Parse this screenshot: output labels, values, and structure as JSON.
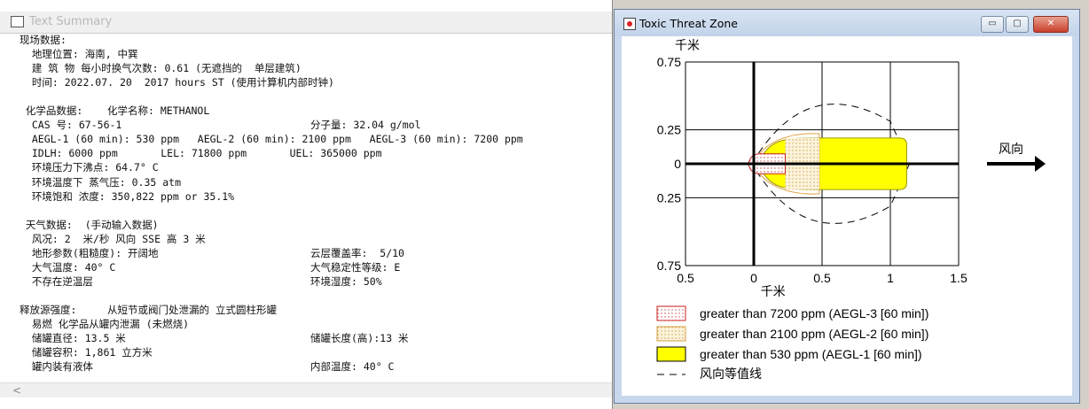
{
  "left_window": {
    "title": "Text Summary",
    "lines": [
      "现场数据:",
      "  地理位置: 海南, 中巽",
      "  建 筑 物 每小时换气次数: 0.61 (无遮挡的  单层建筑)",
      "  时间: 2022.07. 20  2017 hours ST (使用计算机内部时钟)",
      "",
      " 化学品数据:    化学名称: METHANOL",
      "  CAS 号: 67-56-1",
      "  AEGL-1 (60 min): 530 ppm   AEGL-2 (60 min): 2100 ppm   AEGL-3 (60 min): 7200 ppm",
      "  IDLH: 6000 ppm       LEL: 71800 ppm       UEL: 365000 ppm",
      "  环境压力下沸点: 64.7° C",
      "  环境温度下 蒸气压: 0.35 atm",
      "  环境饱和 浓度: 350,822 ppm or 35.1%",
      "",
      " 天气数据:  (手动输入数据)",
      "  风况: 2  米/秒 风向 SSE 高 3 米",
      "  地形参数(粗糙度): 开阔地",
      "  大气温度: 40° C",
      "  不存在逆温层",
      "",
      "释放源强度:     从短节或阀门处泄漏的 立式圆柱形罐",
      "  易燃 化学品从罐内泄漏 (未燃烧)",
      "  储罐直径: 13.5 米",
      "  储罐容积: 1,861 立方米",
      "  罐内装有液体"
    ],
    "right_column": [
      {
        "row": 6,
        "text": "分子量: 32.04 g/mol"
      },
      {
        "row": 15,
        "text": "云层覆盖率:  5/10"
      },
      {
        "row": 16,
        "text": "大气稳定性等级: E"
      },
      {
        "row": 17,
        "text": "环境湿度: 50%"
      },
      {
        "row": 21,
        "text": "储罐长度(高):13 米"
      },
      {
        "row": 23,
        "text": "内部温度: 40° C"
      }
    ],
    "scroll_arrow": "<"
  },
  "right_window": {
    "title": "Toxic Threat Zone",
    "buttons": {
      "minimize": "▭",
      "maximize": "▢",
      "close": "✕"
    },
    "title_icon": "app-icon"
  },
  "chart_data": {
    "type": "area",
    "xlabel": "千米",
    "ylabel": "千米",
    "x_ticks": [
      "0.5",
      "0",
      "0.5",
      "1",
      "1.5"
    ],
    "y_ticks": [
      "0.75",
      "0.25",
      "0",
      "0.25",
      "0.75"
    ],
    "xlim": [
      -0.5,
      1.5
    ],
    "ylim": [
      -0.75,
      0.75
    ],
    "grid": true,
    "wind_label": "风向",
    "zones": [
      {
        "name": "greater than 7200 ppm (AEGL-3 [60 min])",
        "color": "#f4c8c8",
        "edge": "#cc2222",
        "extent_km": 0.23,
        "halfwidth_km": 0.07
      },
      {
        "name": "greater than 2100 ppm (AEGL-2 [60 min])",
        "color": "#f5e6c0",
        "edge": "#e0a040",
        "extent_km": 0.48,
        "halfwidth_km": 0.26
      },
      {
        "name": "greater than 530 ppm (AEGL-1 [60 min])",
        "color": "#ffff00",
        "edge": "#999900",
        "extent_km": 1.12,
        "halfwidth_km": 0.19
      }
    ],
    "confidence_line": {
      "name": "风向等值线",
      "extent_km": 1.14,
      "halfwidth_km": 0.52
    },
    "legend": [
      "greater than 7200 ppm (AEGL-3 [60 min])",
      "greater than 2100 ppm (AEGL-2 [60 min])",
      "greater than 530 ppm (AEGL-1 [60 min])",
      "风向等值线"
    ]
  }
}
